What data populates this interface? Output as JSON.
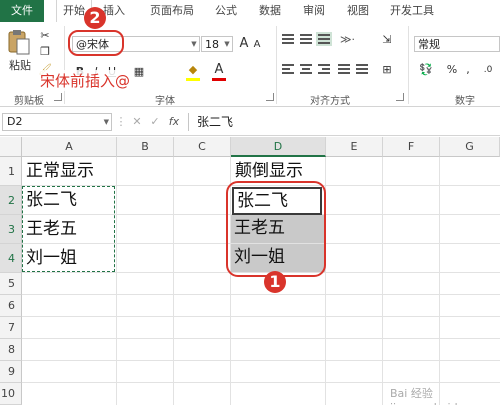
{
  "ribbon_tabs": [
    "文件",
    "开始",
    "插入",
    "页面布局",
    "公式",
    "数据",
    "审阅",
    "视图",
    "开发工具"
  ],
  "clipboard": {
    "paste_label": "粘贴",
    "group_label": "剪贴板"
  },
  "font": {
    "name_value": "@宋体",
    "size_value": "18",
    "grow": "A",
    "shrink": "A",
    "bold": "B",
    "italic": "I",
    "underline": "U",
    "font_color": "A",
    "group_label": "字体"
  },
  "alignment": {
    "group_label": "对齐方式"
  },
  "number": {
    "format_value": "常规",
    "percent": "%",
    "comma": ",",
    "group_label": "数字"
  },
  "annotation": {
    "text": "宋体前插入@",
    "badge_font": "2",
    "badge_range": "1"
  },
  "formula_bar": {
    "name_box": "D2",
    "fx": "fx",
    "content": "张二飞"
  },
  "columns": [
    "A",
    "B",
    "C",
    "D",
    "E",
    "F",
    "G"
  ],
  "rows": [
    "1",
    "2",
    "3",
    "4",
    "5",
    "6",
    "7",
    "8",
    "9",
    "10"
  ],
  "cells": {
    "A1": "正常显示",
    "A2": "张二飞",
    "A3": "王老五",
    "A4": "刘一姐",
    "D1": "颠倒显示",
    "D2": "张二飞",
    "D3": "王老五",
    "D4": "刘一姐"
  },
  "watermark": "Bai 经验 jingyan.baidu.com",
  "colors": {
    "excel_green": "#217346",
    "annotation_red": "#d9342b",
    "selection_gray": "#c9c9c9"
  }
}
